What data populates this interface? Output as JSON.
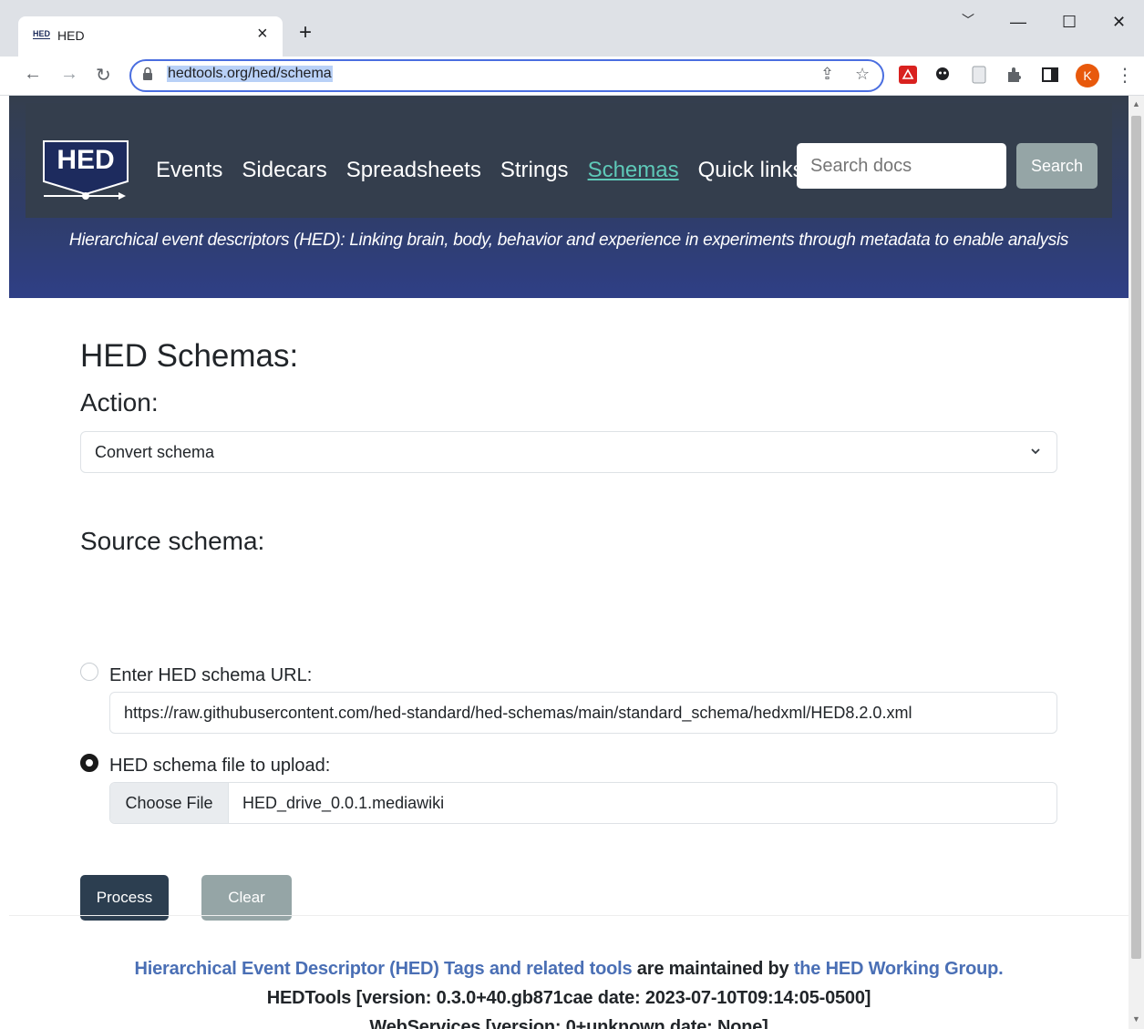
{
  "browser": {
    "tab_title": "HED",
    "tab_favicon": "HED",
    "url": "hedtools.org/hed/schema",
    "profile_initial": "K",
    "icons": [
      "back-icon",
      "forward-icon",
      "reload-icon",
      "lock-icon",
      "share-icon",
      "star-icon",
      "pdf-extension-icon",
      "ghost-extension-icon",
      "page-extension-icon",
      "puzzle-icon",
      "sidepanel-icon",
      "kebab-menu-icon"
    ]
  },
  "header": {
    "logo_text": "HED",
    "nav": {
      "events": "Events",
      "sidecars": "Sidecars",
      "spreadsheets": "Spreadsheets",
      "strings": "Strings",
      "schemas": "Schemas",
      "quick_links": "Quick links"
    },
    "search_placeholder": "Search docs",
    "search_button": "Search",
    "tagline": "Hierarchical event descriptors (HED): Linking brain, body, behavior and experience in experiments through metadata to enable analysis"
  },
  "main": {
    "title": "HED Schemas:",
    "action_label": "Action:",
    "action_selected": "Convert schema",
    "source_label": "Source schema:",
    "url_option_label": "Enter HED schema URL:",
    "url_value": "https://raw.githubusercontent.com/hed-standard/hed-schemas/main/standard_schema/hedxml/HED8.2.0.xml",
    "file_option_label": "HED schema file to upload:",
    "choose_file": "Choose File",
    "file_name": "HED_drive_0.0.1.mediawiki",
    "selected_source": "file",
    "process_button": "Process",
    "clear_button": "Clear"
  },
  "footer": {
    "link1": "Hierarchical Event Descriptor (HED) Tags and related tools",
    "text1": " are maintained by ",
    "link2": "the HED Working Group.",
    "version_line": "HEDTools [version: 0.3.0+40.gb871cae date: 2023-07-10T09:14:05-0500]",
    "webservices_line": "WebServices [version: 0+unknown date: None]"
  },
  "colors": {
    "navbar": "#343e4d",
    "hero_bottom": "#2f3f86",
    "active_link": "#5ec9b8",
    "primary_button": "#2c3e50",
    "secondary_button": "#95a5a6",
    "footer_link": "#4a6fb5"
  }
}
